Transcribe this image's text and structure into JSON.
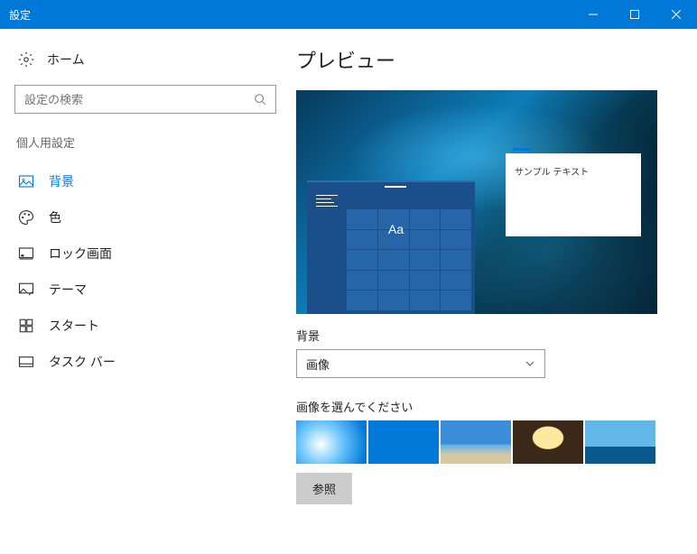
{
  "titlebar": {
    "title": "設定"
  },
  "sidebar": {
    "home": "ホーム",
    "search_placeholder": "設定の検索",
    "category": "個人用設定",
    "items": [
      {
        "label": "背景"
      },
      {
        "label": "色"
      },
      {
        "label": "ロック画面"
      },
      {
        "label": "テーマ"
      },
      {
        "label": "スタート"
      },
      {
        "label": "タスク バー"
      }
    ]
  },
  "main": {
    "heading": "プレビュー",
    "preview_sample_text": "サンプル テキスト",
    "preview_aa": "Aa",
    "bg_label": "背景",
    "bg_select_value": "画像",
    "choose_label": "画像を選んでください",
    "browse": "参照"
  }
}
